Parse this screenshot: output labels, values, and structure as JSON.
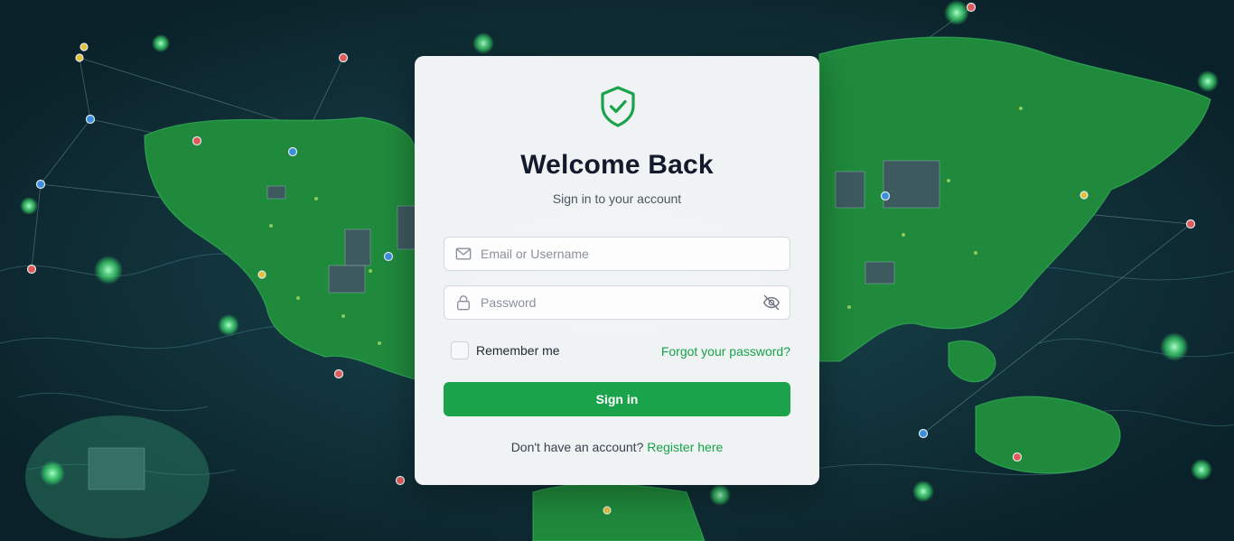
{
  "colors": {
    "accent": "#1aa34a",
    "link": "#17a34a",
    "title": "#131a2c",
    "background": "#0c2a33",
    "land": "#1f8a3c"
  },
  "logo": {
    "icon": "shield-check-icon"
  },
  "heading": {
    "title": "Welcome Back",
    "subtitle": "Sign in to your account"
  },
  "form": {
    "username": {
      "icon": "mail-icon",
      "placeholder": "Email or Username",
      "value": ""
    },
    "password": {
      "icon": "lock-icon",
      "placeholder": "Password",
      "value": "",
      "toggle_icon": "eye-off-icon"
    },
    "remember": {
      "label": "Remember me",
      "checked": false
    },
    "forgot_link": "Forgot your password?",
    "submit_label": "Sign in"
  },
  "footer": {
    "prompt": "Don't have an account?",
    "register_link": "Register here"
  }
}
